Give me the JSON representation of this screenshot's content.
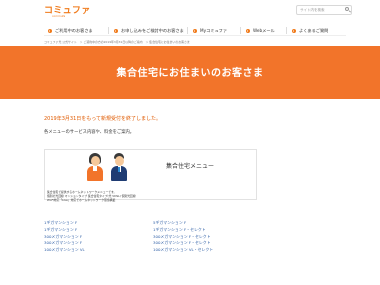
{
  "header": {
    "logo": "コミュファ",
    "logo_sub": "commufa",
    "search_placeholder": "サイト内を検索"
  },
  "nav": {
    "items": [
      {
        "label": "ご利用中のお客さま"
      },
      {
        "label": "お申し込みをご検討中のお客さま"
      },
      {
        "label": "Myコミュファ"
      },
      {
        "label": "Webメール"
      },
      {
        "label": "よくあるご質問"
      }
    ]
  },
  "breadcrumb": [
    "コミュファ光 公式サイト",
    "＞ ご契約中の方の2019年3月31日以降のご案内",
    "＞ 集合住宅にお住まいのお客さま"
  ],
  "hero": {
    "title": "集合住宅にお住まいのお客さま"
  },
  "notice": "2019年3月31日をもって新規受付を終了しました。",
  "intro": "各メニューのサービス内容や、料金をご案内。",
  "card": {
    "title": "集合住宅メニュー",
    "desc": [
      "集合住宅で提供するホームネットワークメニューです。",
      "個別の光回線 マンションタイプ 集合住宅タイプ(光 VDSL) 個別光回線",
      "Wi-Fi対応「Live」対応でホームネットワーク環境構築"
    ]
  },
  "links_left": [
    "1ギガマンション F",
    "1ギガマンション F",
    "300メガマンション F",
    "300メガマンション F",
    "100メガマンション VL"
  ],
  "links_right": [
    "5ギガマンション F",
    "1ギガマンション F・セレクト",
    "300メガマンション F・セレクト",
    "300メガマンション F・セレクト",
    "100メガマンション VL・セレクト"
  ],
  "colors": {
    "brand": "#f2742a",
    "link": "#2f5fa6"
  }
}
